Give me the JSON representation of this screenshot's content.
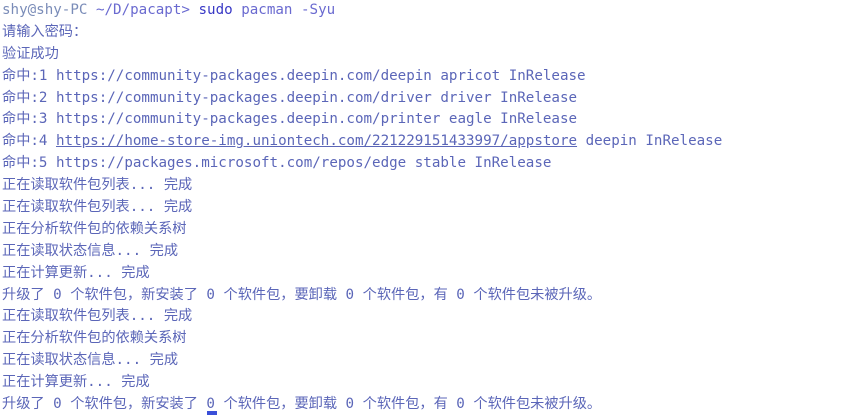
{
  "terminal": {
    "prompt": {
      "user_host": "shy@shy-PC",
      "path": "~/D/pacapt",
      "symbol": ">",
      "command": "sudo",
      "args": "pacman -Syu"
    },
    "password_prompt": "请输入密码：",
    "auth_ok": "验证成功",
    "hits": [
      {
        "prefix": "命中:1 ",
        "url": "https://community-packages.deepin.com/deepin",
        "suffix": " apricot InRelease"
      },
      {
        "prefix": "命中:2 ",
        "url": "https://community-packages.deepin.com/driver",
        "suffix": " driver InRelease"
      },
      {
        "prefix": "命中:3 ",
        "url": "https://community-packages.deepin.com/printer",
        "suffix": " eagle InRelease"
      },
      {
        "prefix": "命中:4 ",
        "url": "https://home-store-img.uniontech.com/221229151433997/appstore",
        "suffix": " deepin InRelease"
      },
      {
        "prefix": "命中:5 ",
        "url": "https://packages.microsoft.com/repos/edge",
        "suffix": " stable InRelease"
      }
    ],
    "lines_a": [
      "正在读取软件包列表... 完成",
      "正在读取软件包列表... 完成",
      "正在分析软件包的依赖关系树",
      "正在读取状态信息... 完成",
      "正在计算更新... 完成",
      "升级了 0 个软件包，新安装了 0 个软件包，要卸载 0 个软件包，有 0 个软件包未被升级。"
    ],
    "lines_b": [
      "正在读取软件包列表... 完成",
      "正在分析软件包的依赖关系树",
      "正在读取状态信息... 完成",
      "正在计算更新... 完成",
      "升级了 0 个软件包，新安装了 0 个软件包，要卸载 0 个软件包，有 0 个软件包未被升级。"
    ],
    "colors": {
      "background": "#ffffff",
      "text": "#5b66b8",
      "cursor": "#3a4fd8"
    }
  }
}
